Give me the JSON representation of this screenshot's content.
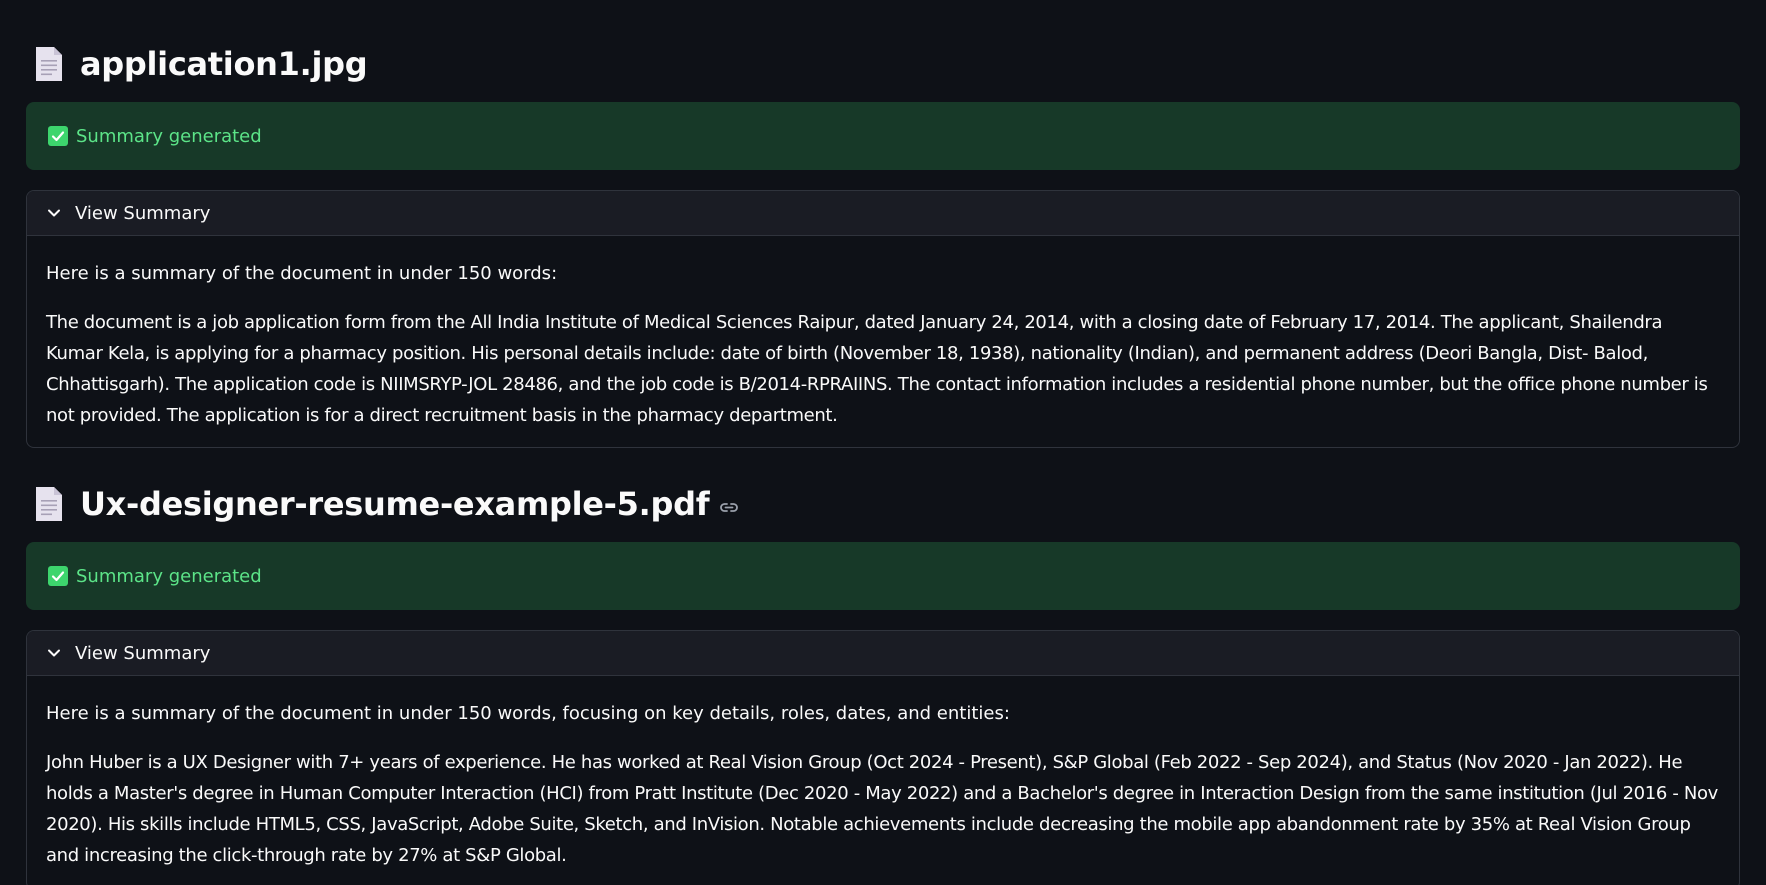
{
  "documents": [
    {
      "filename": "application1.jpg",
      "status": "Summary generated",
      "expander_label": "View Summary",
      "intro": "Here is a summary of the document in under 150 words:",
      "summary": "The document is a job application form from the All India Institute of Medical Sciences Raipur, dated January 24, 2014, with a closing date of February 17, 2014. The applicant, Shailendra Kumar Kela, is applying for a pharmacy position. His personal details include: date of birth (November 18, 1938), nationality (Indian), and permanent address (Deori Bangla, Dist- Balod, Chhattisgarh). The application code is NIIMSRYP-JOL 28486, and the job code is B/2014-RPRAIINS. The contact information includes a residential phone number, but the office phone number is not provided. The application is for a direct recruitment basis in the pharmacy department."
    },
    {
      "filename": "Ux-designer-resume-example-5.pdf",
      "status": "Summary generated",
      "expander_label": "View Summary",
      "intro": "Here is a summary of the document in under 150 words, focusing on key details, roles, dates, and entities:",
      "summary": "John Huber is a UX Designer with 7+ years of experience. He has worked at Real Vision Group (Oct 2024 - Present), S&P Global (Feb 2022 - Sep 2024), and Status (Nov 2020 - Jan 2022). He holds a Master's degree in Human Computer Interaction (HCI) from Pratt Institute (Dec 2020 - May 2022) and a Bachelor's degree in Interaction Design from the same institution (Jul 2016 - Nov 2020). His skills include HTML5, CSS, JavaScript, Adobe Suite, Sketch, and InVision. Notable achievements include decreasing the mobile app abandonment rate by 35% at Real Vision Group and increasing the click-through rate by 27% at S&P Global."
    }
  ],
  "icons": {
    "document": "document-icon",
    "status": "check-icon",
    "expander": "chevron-down-icon",
    "anchor": "link-icon"
  },
  "colors": {
    "background": "#0e1117",
    "success_bg": "#173928",
    "success_text": "#5ce488",
    "expander_header_bg": "#1a1c24",
    "border": "#2f333c"
  }
}
